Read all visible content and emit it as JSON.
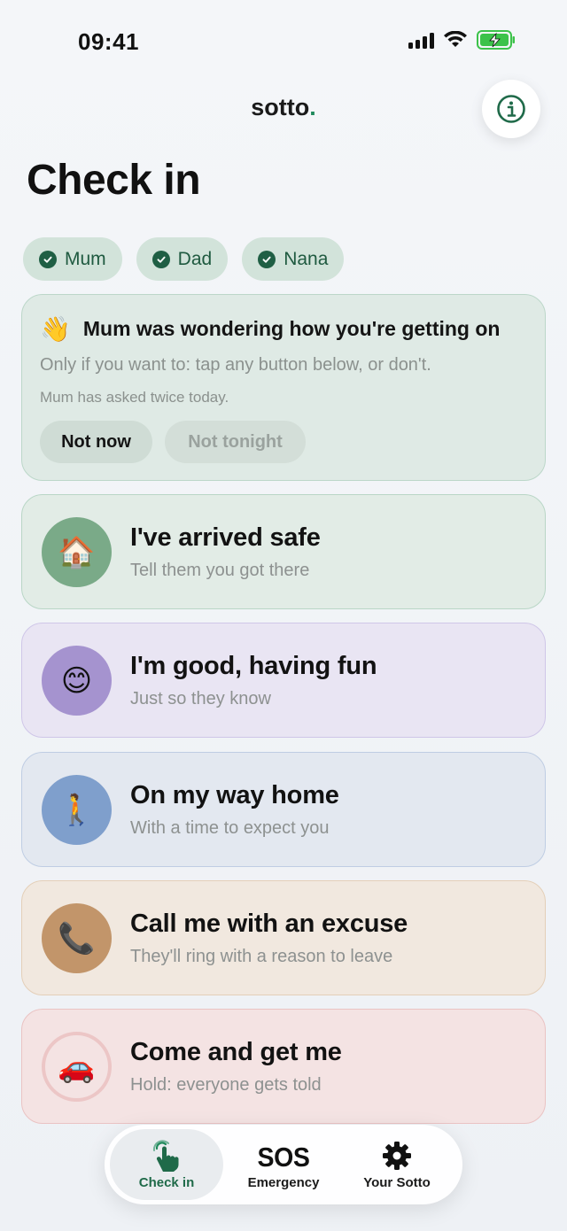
{
  "status_bar": {
    "time": "09:41"
  },
  "header": {
    "brand": "sotto",
    "brand_dot": ".",
    "info_icon": "info-icon"
  },
  "page": {
    "title": "Check in"
  },
  "contacts": [
    {
      "name": "Mum",
      "icon": "check-circle-icon"
    },
    {
      "name": "Dad",
      "icon": "check-circle-icon"
    },
    {
      "name": "Nana",
      "icon": "check-circle-icon"
    }
  ],
  "prompt": {
    "emoji": "👋",
    "title": "Mum was wondering how you're getting on",
    "subtitle": "Only if you want to: tap any button below, or don't.",
    "note": "Mum has asked twice today.",
    "not_now_label": "Not now",
    "not_tonight_label": "Not tonight"
  },
  "actions": [
    {
      "emoji": "🏠",
      "title": "I've arrived safe",
      "subtitle": "Tell them you got there",
      "bg": "#e2ece6",
      "border": "#b9d6c6",
      "circle": "#7aaa88"
    },
    {
      "emoji": "😊",
      "title": "I'm good, having fun",
      "subtitle": "Just so they know",
      "bg": "#e9e5f3",
      "border": "#cfc6e8",
      "circle": "#a593cf"
    },
    {
      "emoji": "🚶",
      "title": "On my way home",
      "subtitle": "With a time to expect you",
      "bg": "#e3e8f0",
      "border": "#bfcde3",
      "circle": "#7f9fcc"
    },
    {
      "emoji": "📞",
      "title": "Call me with an excuse",
      "subtitle": "They'll ring with a reason to leave",
      "bg": "#f1e8df",
      "border": "#e4cfb8",
      "circle": "#c2956a"
    },
    {
      "emoji": "🚗",
      "title": "Come and get me",
      "subtitle": "Hold: everyone gets told",
      "bg": "#f4e3e3",
      "border": "#eac3c3",
      "circle": "#f4e3e3"
    }
  ],
  "nav": {
    "items": [
      {
        "label": "Check in",
        "icon": "hand-pointer-icon"
      },
      {
        "label": "Emergency",
        "icon_text": "SOS"
      },
      {
        "label": "Your Sotto",
        "icon": "gear-icon"
      }
    ]
  }
}
